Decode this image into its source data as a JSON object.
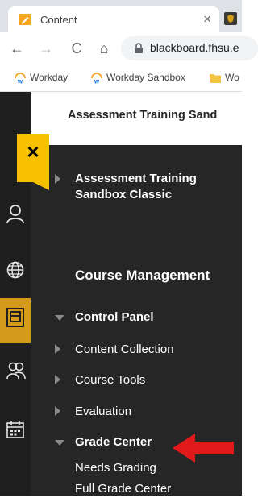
{
  "browser": {
    "tab_title": "Content",
    "tab_close": "×",
    "url": "blackboard.fhsu.e",
    "nav": {
      "back": "←",
      "forward": "→",
      "reload": "C",
      "home": "⌂"
    },
    "bookmarks": [
      "Workday",
      "Workday Sandbox",
      "Wo"
    ]
  },
  "course": {
    "header_title": "Assessment Training Sand"
  },
  "menu": {
    "close_label": "×",
    "course_title_line1": "Assessment Training",
    "course_title_line2": "Sandbox Classic",
    "section_heading": "Course Management",
    "control_panel": "Control Panel",
    "items": [
      {
        "label": "Content Collection"
      },
      {
        "label": "Course Tools"
      },
      {
        "label": "Evaluation"
      }
    ],
    "grade_center": "Grade Center",
    "grade_center_children": [
      {
        "label": "Needs Grading"
      },
      {
        "label": "Full Grade Center"
      }
    ]
  },
  "colors": {
    "accent_yellow": "#f7c000",
    "rail_active": "#d49a1a",
    "menu_bg": "#262626",
    "arrow_red": "#e0191b"
  },
  "rail_icons": [
    "user-icon",
    "globe-icon",
    "courses-icon",
    "groups-icon",
    "calendar-icon"
  ]
}
